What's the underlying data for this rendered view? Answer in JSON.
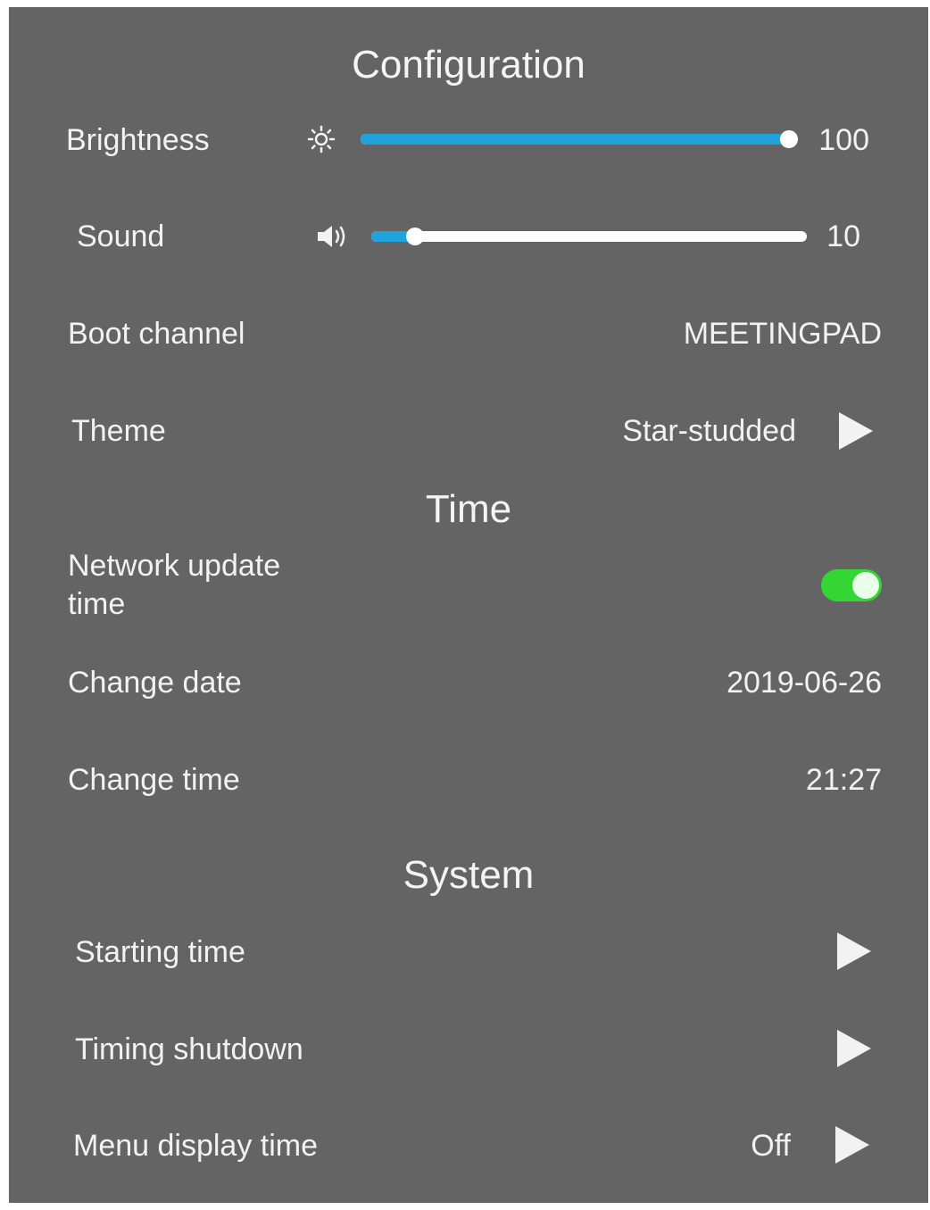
{
  "colors": {
    "panel_bg": "#646464",
    "accent": "#1ea3dc",
    "toggle_on": "#33d633",
    "text": "#f2f2f2"
  },
  "configuration": {
    "title": "Configuration",
    "brightness": {
      "label": "Brightness",
      "icon": "sun-icon",
      "value": 100,
      "value_text": "100",
      "max": 100
    },
    "sound": {
      "label": "Sound",
      "icon": "speaker-icon",
      "value": 10,
      "value_text": "10",
      "max": 100
    },
    "boot_channel": {
      "label": "Boot channel",
      "value": "MEETINGPAD"
    },
    "theme": {
      "label": "Theme",
      "value": "Star-studded",
      "icon": "play-arrow-icon"
    }
  },
  "time": {
    "title": "Time",
    "network_update": {
      "label_line1": "Network update",
      "label_line2": "time",
      "enabled": true
    },
    "change_date": {
      "label": "Change date",
      "value": "2019-06-26"
    },
    "change_time": {
      "label": "Change time",
      "value": "21:27"
    }
  },
  "system": {
    "title": "System",
    "starting_time": {
      "label": "Starting time",
      "icon": "play-arrow-icon"
    },
    "timing_shutdown": {
      "label": "Timing shutdown",
      "icon": "play-arrow-icon"
    },
    "menu_display_time": {
      "label": "Menu display time",
      "value": "Off",
      "icon": "play-arrow-icon"
    }
  }
}
